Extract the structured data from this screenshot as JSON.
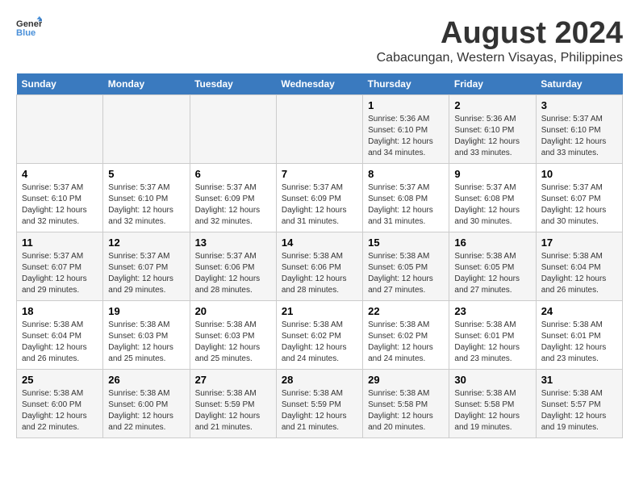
{
  "logo": {
    "line1": "General",
    "line2": "Blue"
  },
  "title": "August 2024",
  "subtitle": "Cabacungan, Western Visayas, Philippines",
  "days_of_week": [
    "Sunday",
    "Monday",
    "Tuesday",
    "Wednesday",
    "Thursday",
    "Friday",
    "Saturday"
  ],
  "weeks": [
    [
      {
        "day": "",
        "info": ""
      },
      {
        "day": "",
        "info": ""
      },
      {
        "day": "",
        "info": ""
      },
      {
        "day": "",
        "info": ""
      },
      {
        "day": "1",
        "info": "Sunrise: 5:36 AM\nSunset: 6:10 PM\nDaylight: 12 hours\nand 34 minutes."
      },
      {
        "day": "2",
        "info": "Sunrise: 5:36 AM\nSunset: 6:10 PM\nDaylight: 12 hours\nand 33 minutes."
      },
      {
        "day": "3",
        "info": "Sunrise: 5:37 AM\nSunset: 6:10 PM\nDaylight: 12 hours\nand 33 minutes."
      }
    ],
    [
      {
        "day": "4",
        "info": "Sunrise: 5:37 AM\nSunset: 6:10 PM\nDaylight: 12 hours\nand 32 minutes."
      },
      {
        "day": "5",
        "info": "Sunrise: 5:37 AM\nSunset: 6:10 PM\nDaylight: 12 hours\nand 32 minutes."
      },
      {
        "day": "6",
        "info": "Sunrise: 5:37 AM\nSunset: 6:09 PM\nDaylight: 12 hours\nand 32 minutes."
      },
      {
        "day": "7",
        "info": "Sunrise: 5:37 AM\nSunset: 6:09 PM\nDaylight: 12 hours\nand 31 minutes."
      },
      {
        "day": "8",
        "info": "Sunrise: 5:37 AM\nSunset: 6:08 PM\nDaylight: 12 hours\nand 31 minutes."
      },
      {
        "day": "9",
        "info": "Sunrise: 5:37 AM\nSunset: 6:08 PM\nDaylight: 12 hours\nand 30 minutes."
      },
      {
        "day": "10",
        "info": "Sunrise: 5:37 AM\nSunset: 6:07 PM\nDaylight: 12 hours\nand 30 minutes."
      }
    ],
    [
      {
        "day": "11",
        "info": "Sunrise: 5:37 AM\nSunset: 6:07 PM\nDaylight: 12 hours\nand 29 minutes."
      },
      {
        "day": "12",
        "info": "Sunrise: 5:37 AM\nSunset: 6:07 PM\nDaylight: 12 hours\nand 29 minutes."
      },
      {
        "day": "13",
        "info": "Sunrise: 5:37 AM\nSunset: 6:06 PM\nDaylight: 12 hours\nand 28 minutes."
      },
      {
        "day": "14",
        "info": "Sunrise: 5:38 AM\nSunset: 6:06 PM\nDaylight: 12 hours\nand 28 minutes."
      },
      {
        "day": "15",
        "info": "Sunrise: 5:38 AM\nSunset: 6:05 PM\nDaylight: 12 hours\nand 27 minutes."
      },
      {
        "day": "16",
        "info": "Sunrise: 5:38 AM\nSunset: 6:05 PM\nDaylight: 12 hours\nand 27 minutes."
      },
      {
        "day": "17",
        "info": "Sunrise: 5:38 AM\nSunset: 6:04 PM\nDaylight: 12 hours\nand 26 minutes."
      }
    ],
    [
      {
        "day": "18",
        "info": "Sunrise: 5:38 AM\nSunset: 6:04 PM\nDaylight: 12 hours\nand 26 minutes."
      },
      {
        "day": "19",
        "info": "Sunrise: 5:38 AM\nSunset: 6:03 PM\nDaylight: 12 hours\nand 25 minutes."
      },
      {
        "day": "20",
        "info": "Sunrise: 5:38 AM\nSunset: 6:03 PM\nDaylight: 12 hours\nand 25 minutes."
      },
      {
        "day": "21",
        "info": "Sunrise: 5:38 AM\nSunset: 6:02 PM\nDaylight: 12 hours\nand 24 minutes."
      },
      {
        "day": "22",
        "info": "Sunrise: 5:38 AM\nSunset: 6:02 PM\nDaylight: 12 hours\nand 24 minutes."
      },
      {
        "day": "23",
        "info": "Sunrise: 5:38 AM\nSunset: 6:01 PM\nDaylight: 12 hours\nand 23 minutes."
      },
      {
        "day": "24",
        "info": "Sunrise: 5:38 AM\nSunset: 6:01 PM\nDaylight: 12 hours\nand 23 minutes."
      }
    ],
    [
      {
        "day": "25",
        "info": "Sunrise: 5:38 AM\nSunset: 6:00 PM\nDaylight: 12 hours\nand 22 minutes."
      },
      {
        "day": "26",
        "info": "Sunrise: 5:38 AM\nSunset: 6:00 PM\nDaylight: 12 hours\nand 22 minutes."
      },
      {
        "day": "27",
        "info": "Sunrise: 5:38 AM\nSunset: 5:59 PM\nDaylight: 12 hours\nand 21 minutes."
      },
      {
        "day": "28",
        "info": "Sunrise: 5:38 AM\nSunset: 5:59 PM\nDaylight: 12 hours\nand 21 minutes."
      },
      {
        "day": "29",
        "info": "Sunrise: 5:38 AM\nSunset: 5:58 PM\nDaylight: 12 hours\nand 20 minutes."
      },
      {
        "day": "30",
        "info": "Sunrise: 5:38 AM\nSunset: 5:58 PM\nDaylight: 12 hours\nand 19 minutes."
      },
      {
        "day": "31",
        "info": "Sunrise: 5:38 AM\nSunset: 5:57 PM\nDaylight: 12 hours\nand 19 minutes."
      }
    ]
  ]
}
